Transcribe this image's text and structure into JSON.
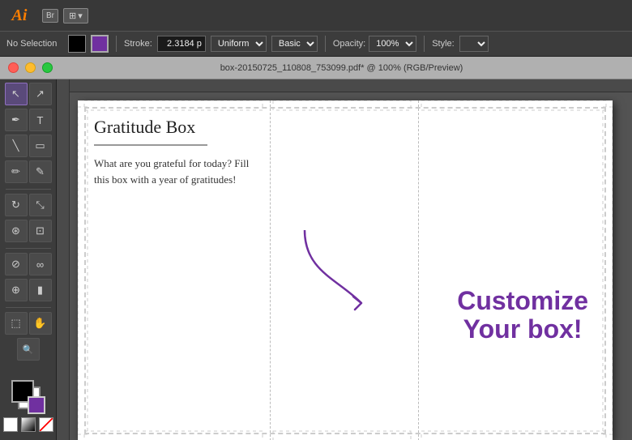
{
  "app": {
    "logo": "Ai",
    "br_badge": "Br",
    "title": "Adobe Illustrator"
  },
  "menubar": {
    "arrangement_icon": "⊞"
  },
  "toolbar": {
    "no_selection": "No Selection",
    "stroke_label": "Stroke:",
    "stroke_value": "2.3184 p",
    "uniform_label": "Uniform",
    "basic_label": "Basic",
    "opacity_label": "Opacity:",
    "opacity_value": "100%",
    "style_label": "Style:"
  },
  "window": {
    "traffic_lights": [
      "red",
      "yellow",
      "green"
    ],
    "title": "box-20150725_110808_753099.pdf* @ 100% (RGB/Preview)"
  },
  "canvas": {
    "document_title": "Gratitude Box",
    "underline_present": true,
    "body_text": "What are you grateful for today? Fill this box with a year of gratitudes!",
    "customize_line1": "Customize",
    "customize_line2": "Your box!"
  },
  "tools": [
    {
      "name": "selection",
      "icon": "↖",
      "active": true
    },
    {
      "name": "direct-selection",
      "icon": "↗",
      "active": false
    },
    {
      "name": "pen",
      "icon": "✒",
      "active": false
    },
    {
      "name": "type",
      "icon": "T",
      "active": false
    },
    {
      "name": "line",
      "icon": "╲",
      "active": false
    },
    {
      "name": "rectangle",
      "icon": "▭",
      "active": false
    },
    {
      "name": "paintbrush",
      "icon": "✏",
      "active": false
    },
    {
      "name": "pencil",
      "icon": "✎",
      "active": false
    },
    {
      "name": "rotate",
      "icon": "↻",
      "active": false
    },
    {
      "name": "scale",
      "icon": "⤡",
      "active": false
    },
    {
      "name": "warp",
      "icon": "⊛",
      "active": false
    },
    {
      "name": "free-transform",
      "icon": "⊡",
      "active": false
    },
    {
      "name": "eyedropper",
      "icon": "⊘",
      "active": false
    },
    {
      "name": "blend",
      "icon": "∞",
      "active": false
    },
    {
      "name": "symbol-sprayer",
      "icon": "⊕",
      "active": false
    },
    {
      "name": "graph",
      "icon": "▮",
      "active": false
    },
    {
      "name": "artboard",
      "icon": "⬚",
      "active": false
    },
    {
      "name": "hand",
      "icon": "✋",
      "active": false
    },
    {
      "name": "zoom",
      "icon": "🔍",
      "active": false
    }
  ],
  "colors": {
    "foreground": "#000000",
    "background": "#ffffff",
    "accent_purple": "#7030a0"
  }
}
